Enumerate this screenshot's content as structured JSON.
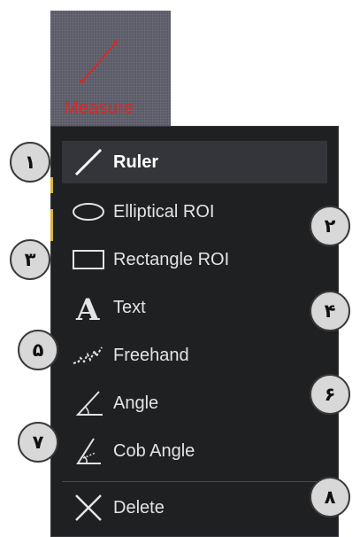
{
  "toolbar": {
    "measure_label": "Measure",
    "measure_icon": "ruler-line-icon",
    "accent_color": "#d42a2a"
  },
  "menu": {
    "items": [
      {
        "label": "Ruler",
        "icon": "ruler-icon",
        "active": true
      },
      {
        "label": "Elliptical ROI",
        "icon": "ellipse-icon"
      },
      {
        "label": "Rectangle ROI",
        "icon": "rectangle-icon"
      },
      {
        "label": "Text",
        "icon": "text-icon"
      },
      {
        "label": "Freehand",
        "icon": "freehand-icon"
      },
      {
        "label": "Angle",
        "icon": "angle-icon"
      },
      {
        "label": "Cob Angle",
        "icon": "cob-angle-icon"
      },
      {
        "label": "Delete",
        "icon": "delete-x-icon"
      }
    ]
  },
  "callouts": [
    "١",
    "٢",
    "٣",
    "۴",
    "۵",
    "۶",
    "٧",
    "٨"
  ]
}
